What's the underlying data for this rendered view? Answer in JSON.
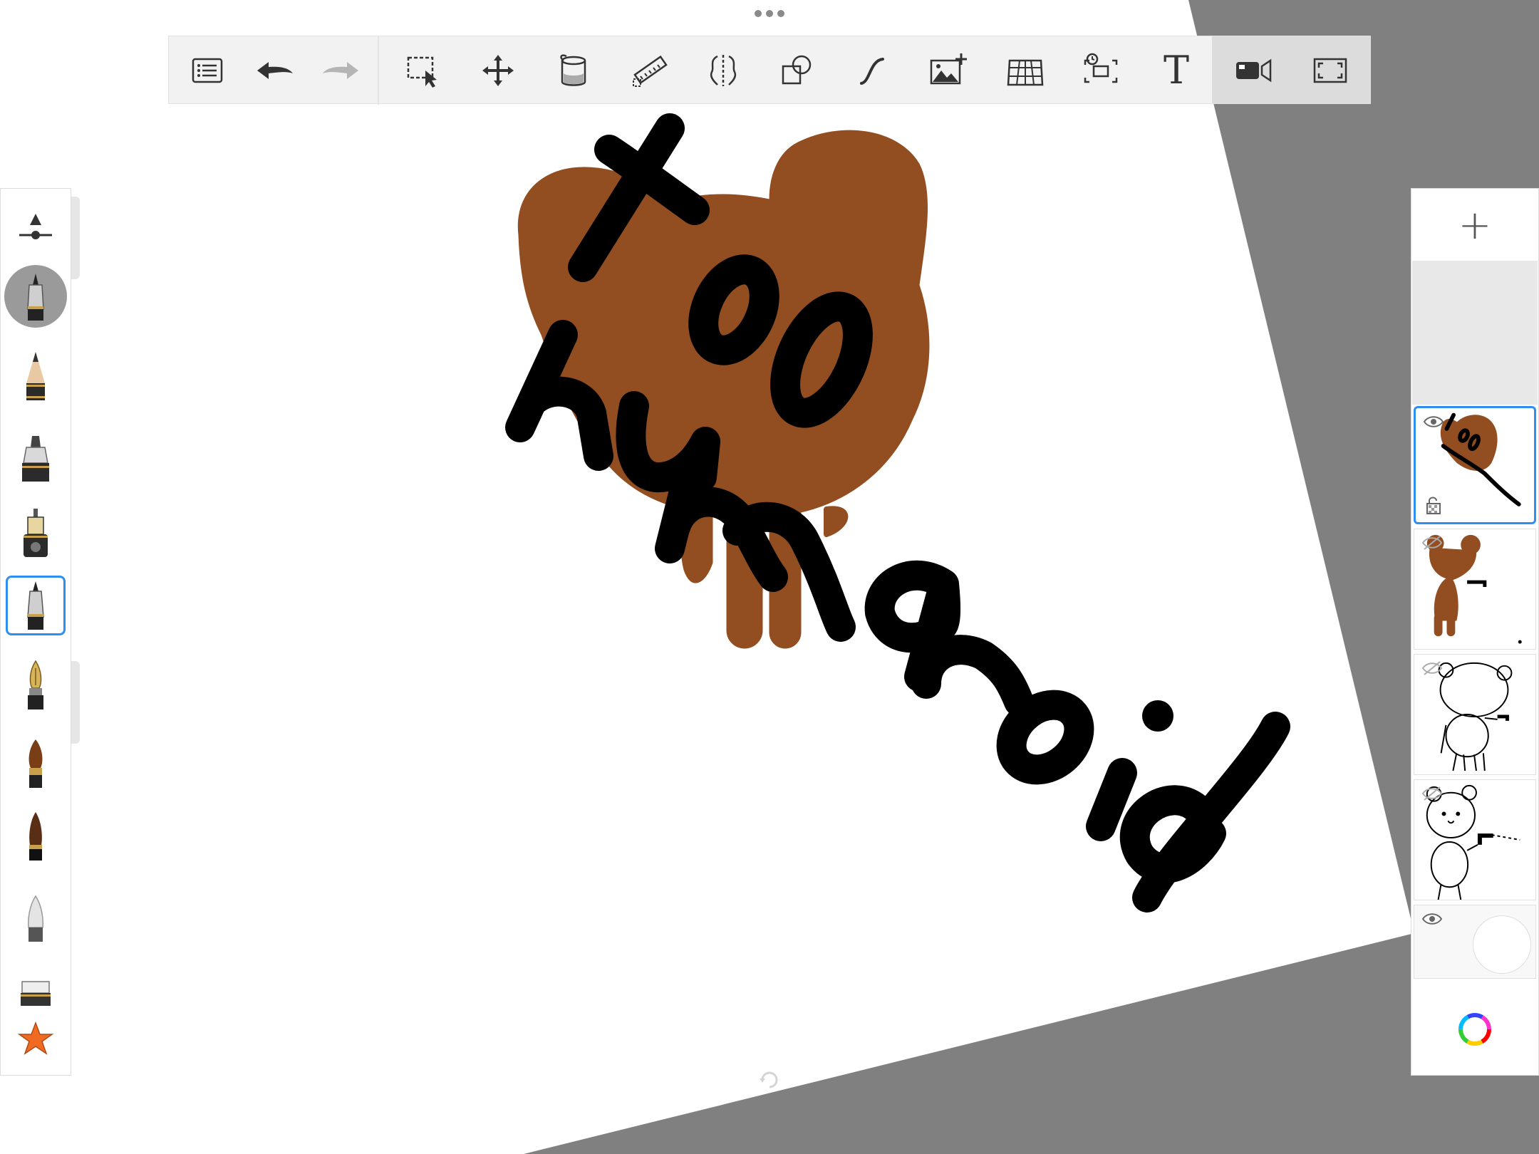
{
  "app": {
    "toolbar": {
      "tools": [
        {
          "id": "list-menu",
          "icon": "list-icon",
          "label": ""
        },
        {
          "id": "undo",
          "icon": "undo-icon",
          "label": ""
        },
        {
          "id": "redo",
          "icon": "redo-icon",
          "label": ""
        },
        {
          "id": "selection",
          "icon": "selection-icon",
          "label": ""
        },
        {
          "id": "transform",
          "icon": "move-icon",
          "label": ""
        },
        {
          "id": "fill",
          "icon": "paint-bucket-icon",
          "label": ""
        },
        {
          "id": "ruler",
          "icon": "ruler-icon",
          "label": ""
        },
        {
          "id": "symmetry",
          "icon": "symmetry-icon",
          "label": ""
        },
        {
          "id": "shapes",
          "icon": "shapes-icon",
          "label": ""
        },
        {
          "id": "stroke",
          "icon": "curve-icon",
          "label": ""
        },
        {
          "id": "add-image",
          "icon": "add-image-icon",
          "label": ""
        },
        {
          "id": "perspective",
          "icon": "perspective-grid-icon",
          "label": ""
        },
        {
          "id": "timelapse",
          "icon": "timelapse-icon",
          "label": ""
        },
        {
          "id": "text",
          "icon": "text-icon",
          "label": "T"
        },
        {
          "id": "record",
          "icon": "video-camera-icon",
          "label": ""
        },
        {
          "id": "fullscreen",
          "icon": "fullscreen-icon",
          "label": ""
        }
      ]
    },
    "brushes": [
      {
        "name": "brush-size-slider-icon"
      },
      {
        "name": "technical-pen"
      },
      {
        "name": "pencil"
      },
      {
        "name": "marker"
      },
      {
        "name": "airbrush"
      },
      {
        "name": "ballpoint-pen"
      },
      {
        "name": "fountain-pen"
      },
      {
        "name": "paint-brush"
      },
      {
        "name": "ink-brush"
      },
      {
        "name": "soft-eraser"
      },
      {
        "name": "hard-eraser"
      },
      {
        "name": "favorites-star-icon"
      }
    ],
    "layers": {
      "add_label": "+",
      "items": [
        {
          "name": "text-layer",
          "visible": true,
          "selected": true,
          "locked_icon": true
        },
        {
          "name": "bear-color-layer",
          "visible": false,
          "selected": false
        },
        {
          "name": "bear-sketch-layer",
          "visible": false,
          "selected": false
        },
        {
          "name": "bear-face-layer",
          "visible": false,
          "selected": false
        },
        {
          "name": "background-layer",
          "visible": true,
          "selected": false
        }
      ]
    },
    "artwork": {
      "text": "too humanoid",
      "bear_color": "#924e20",
      "ink_color": "#000000"
    },
    "colors": {
      "accent": "#2f8ff0",
      "outside_canvas": "#808080",
      "star": "#f06a22"
    }
  }
}
